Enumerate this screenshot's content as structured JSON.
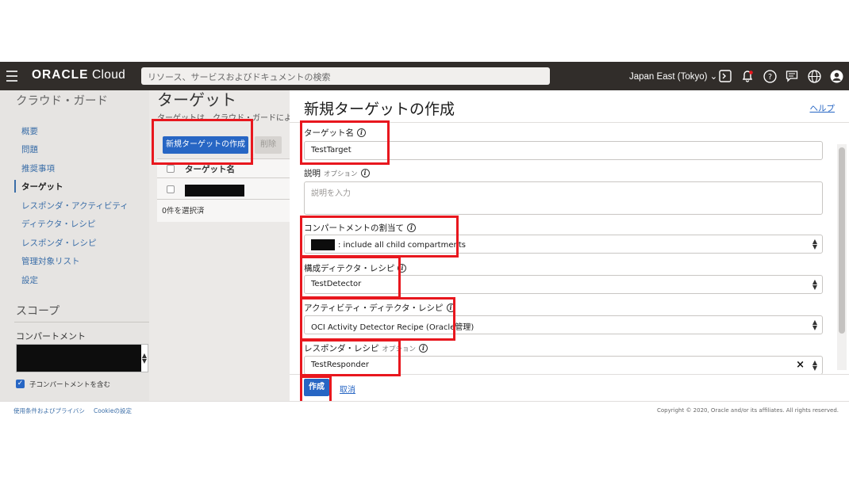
{
  "topbar": {
    "brand_bold": "ORACLE",
    "brand_rest": " Cloud",
    "search_placeholder": "リソース、サービスおよびドキュメントの検索",
    "region": "Japan East (Tokyo)"
  },
  "leftnav": {
    "title": "クラウド・ガード",
    "items": [
      {
        "label": "概要"
      },
      {
        "label": "問題"
      },
      {
        "label": "推奨事項"
      },
      {
        "label": "ターゲット"
      },
      {
        "label": "レスポンダ・アクティビティ"
      },
      {
        "label": "ディテクタ・レシピ"
      },
      {
        "label": "レスポンダ・レシピ"
      },
      {
        "label": "管理対象リスト"
      },
      {
        "label": "設定"
      }
    ],
    "scope_title": "スコープ",
    "compartment_label": "コンパートメント",
    "include_children_label": "子コンパートメントを含む"
  },
  "middle": {
    "title": "ターゲット",
    "description": "ターゲットは、クラウド・ガードによっ",
    "create_button": "新規ターゲットの作成",
    "delete_button": "削除",
    "column_name": "ターゲット名",
    "selected_count": "0件を選択済"
  },
  "panel": {
    "title": "新規ターゲットの作成",
    "help": "ヘルプ",
    "fields": {
      "target_name": {
        "label": "ターゲット名",
        "value": "TestTarget"
      },
      "description": {
        "label": "説明",
        "optional": "オプション",
        "placeholder": "説明を入力"
      },
      "compartment": {
        "label": "コンパートメントの割当て",
        "value": ": include all child compartments"
      },
      "config_detector": {
        "label": "構成ディテクタ・レシピ",
        "value": "TestDetector"
      },
      "activity_detector": {
        "label": "アクティビティ・ディテクタ・レシピ",
        "value": "OCI Activity Detector Recipe (Oracle管理)"
      },
      "responder": {
        "label": "レスポンダ・レシピ",
        "optional": "オプション",
        "value": "TestResponder"
      }
    },
    "create_button": "作成",
    "cancel_link": "取消"
  },
  "footer": {
    "terms_link": "使用条件およびプライバシ",
    "cookie_link": "Cookieの設定",
    "copyright": "Copyright © 2020, Oracle and/or its affiliates. All rights reserved."
  },
  "colors": {
    "topbar_bg": "#312d2a",
    "primary_blue": "#2766c4",
    "annotation_red": "#e8171e"
  }
}
